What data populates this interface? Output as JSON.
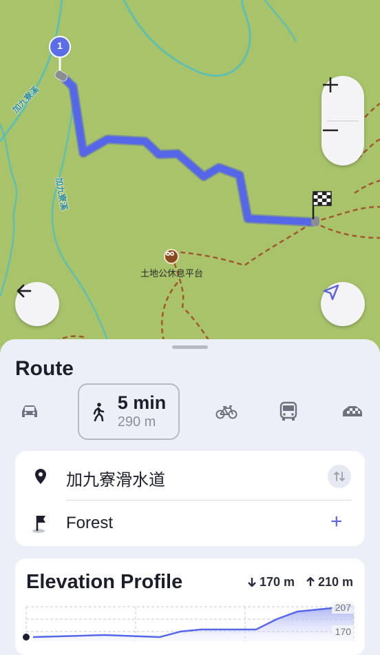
{
  "map": {
    "streams": [
      {
        "label": "加九寮溪"
      },
      {
        "label": "加九寮溪"
      }
    ],
    "poi": {
      "label": "土地公休息平台",
      "icon": "viewpoint-icon"
    },
    "start_marker": {
      "number": "1",
      "color": "#5b6ee8"
    },
    "route_color": "#5566e9",
    "map_color": "#a8c36a",
    "stream_color": "#5fbfb0",
    "trail_color": "#a0572d"
  },
  "controls": {
    "zoom_in_label": "+",
    "zoom_out_label": "−",
    "back_icon": "arrow-left-icon",
    "locate_icon": "navigation-arrow-icon"
  },
  "route": {
    "title": "Route",
    "modes": [
      {
        "name": "car",
        "icon": "car-icon"
      },
      {
        "name": "walk",
        "icon": "walk-icon",
        "selected": true,
        "time": "5 min",
        "distance": "290 m"
      },
      {
        "name": "bicycle",
        "icon": "bicycle-icon"
      },
      {
        "name": "bus",
        "icon": "bus-icon"
      },
      {
        "name": "taxi",
        "icon": "taxi-icon"
      }
    ],
    "from": "加九寮滑水道",
    "to": "Forest",
    "swap_icon": "swap-vertical-icon",
    "add_label": "+"
  },
  "elevation": {
    "title": "Elevation Profile",
    "descent": "170 m",
    "ascent": "210 m",
    "max_label": "207",
    "min_label": "170"
  }
}
